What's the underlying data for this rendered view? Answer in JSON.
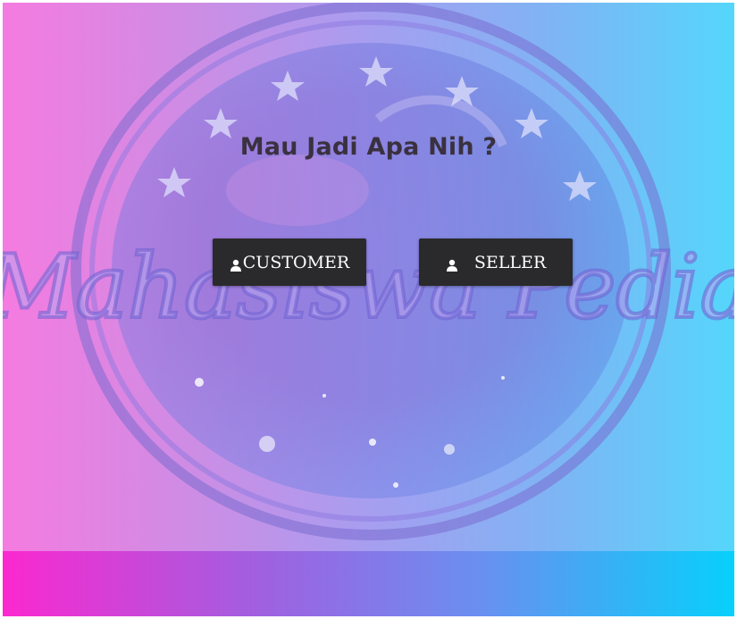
{
  "page": {
    "headline": "Mau Jadi Apa Nih ?",
    "logo_text": "Mahasiswa Pedia"
  },
  "buttons": {
    "customer_label": "CUSTOMER",
    "seller_label": "SELLER",
    "icon": "user-icon"
  },
  "colors": {
    "gradient_left": "#f57be0",
    "gradient_right": "#55d6fb",
    "footer_left": "#fb28cf",
    "footer_right": "#07d0fb",
    "button_bg": "#2a2a2c",
    "headline": "#3a3140"
  }
}
